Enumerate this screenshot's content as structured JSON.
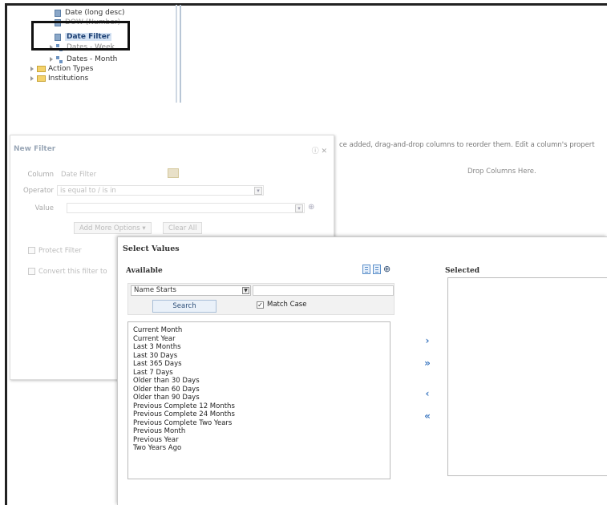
{
  "tree": {
    "items": [
      {
        "label": "Date (long desc)",
        "icon": "column-icon"
      },
      {
        "label": "DOW (Number)",
        "icon": "column-icon"
      },
      {
        "label": "Date Filter",
        "icon": "column-icon",
        "selected": true
      },
      {
        "label": "Dates - Week",
        "icon": "hierarchy-icon"
      },
      {
        "label": "Dates - Month",
        "icon": "hierarchy-icon"
      },
      {
        "label": "Action Types",
        "icon": "folder-icon"
      },
      {
        "label": "Institutions",
        "icon": "folder-icon"
      }
    ]
  },
  "background": {
    "instructions": "ce added, drag-and-drop columns to reorder them. Edit a column's propert",
    "drop_columns": "Drop Columns Here."
  },
  "new_filter": {
    "title": "New Filter",
    "close": "ⓘ ✕",
    "column_label": "Column",
    "column_value": "Date Filter",
    "operator_label": "Operator",
    "operator_value": "is equal to / is in",
    "value_label": "Value",
    "add_more_options": "Add More Options ▾",
    "clear_all": "Clear All",
    "protect_filter": "Protect Filter",
    "convert_filter": "Convert this filter to"
  },
  "select_values": {
    "title": "Select Values",
    "available_label": "Available",
    "selected_label": "Selected",
    "match_type": "Name Starts",
    "search_button": "Search",
    "match_case_label": "Match Case",
    "match_case_checked": true,
    "available_values": [
      "Current Month",
      "Current Year",
      "Last 3 Months",
      "Last 30 Days",
      "Last 365 Days",
      "Last 7 Days",
      "Older than 30 Days",
      "Older than 60 Days",
      "Older than 90 Days",
      "Previous Complete 12 Months",
      "Previous Complete 24 Months",
      "Previous Complete Two Years",
      "Previous Month",
      "Previous Year",
      "Two Years Ago"
    ],
    "move_buttons": {
      "move": "›",
      "move_all": "»",
      "remove": "‹",
      "remove_all": "«"
    }
  }
}
